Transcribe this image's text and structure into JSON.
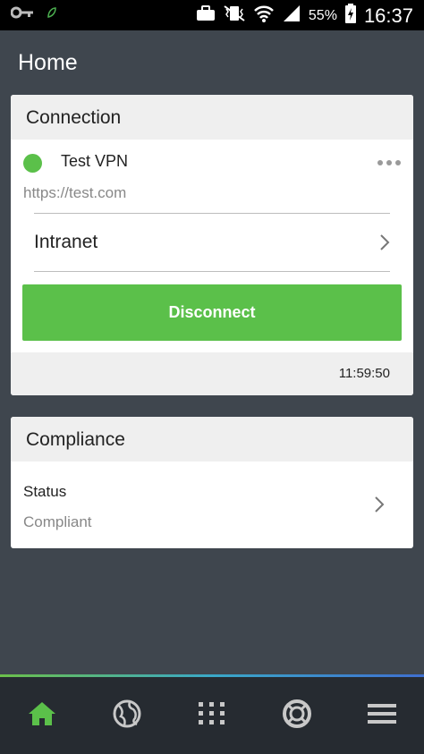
{
  "status_bar": {
    "battery_percent": "55%",
    "time": "16:37",
    "icons": [
      "key-icon",
      "leaf-icon",
      "briefcase-icon",
      "vibrate-mute-icon",
      "wifi-icon",
      "signal-icon",
      "battery-charging-icon"
    ]
  },
  "header": {
    "title": "Home"
  },
  "connection_card": {
    "title": "Connection",
    "status_color": "#5bc04a",
    "name": "Test VPN",
    "url": "https://test.com",
    "network": "Intranet",
    "disconnect_label": "Disconnect",
    "duration": "11:59:50"
  },
  "compliance_card": {
    "title": "Compliance",
    "label": "Status",
    "value": "Compliant"
  },
  "bottom_nav": {
    "items": [
      {
        "icon": "home-icon",
        "active": true,
        "color": "#5bc04a"
      },
      {
        "icon": "globe-icon",
        "active": false
      },
      {
        "icon": "apps-grid-icon",
        "active": false
      },
      {
        "icon": "support-lifebuoy-icon",
        "active": false
      },
      {
        "icon": "menu-icon",
        "active": false
      }
    ]
  },
  "colors": {
    "accent": "#5bc04a",
    "background": "#3f464e",
    "nav_background": "#262b31"
  }
}
